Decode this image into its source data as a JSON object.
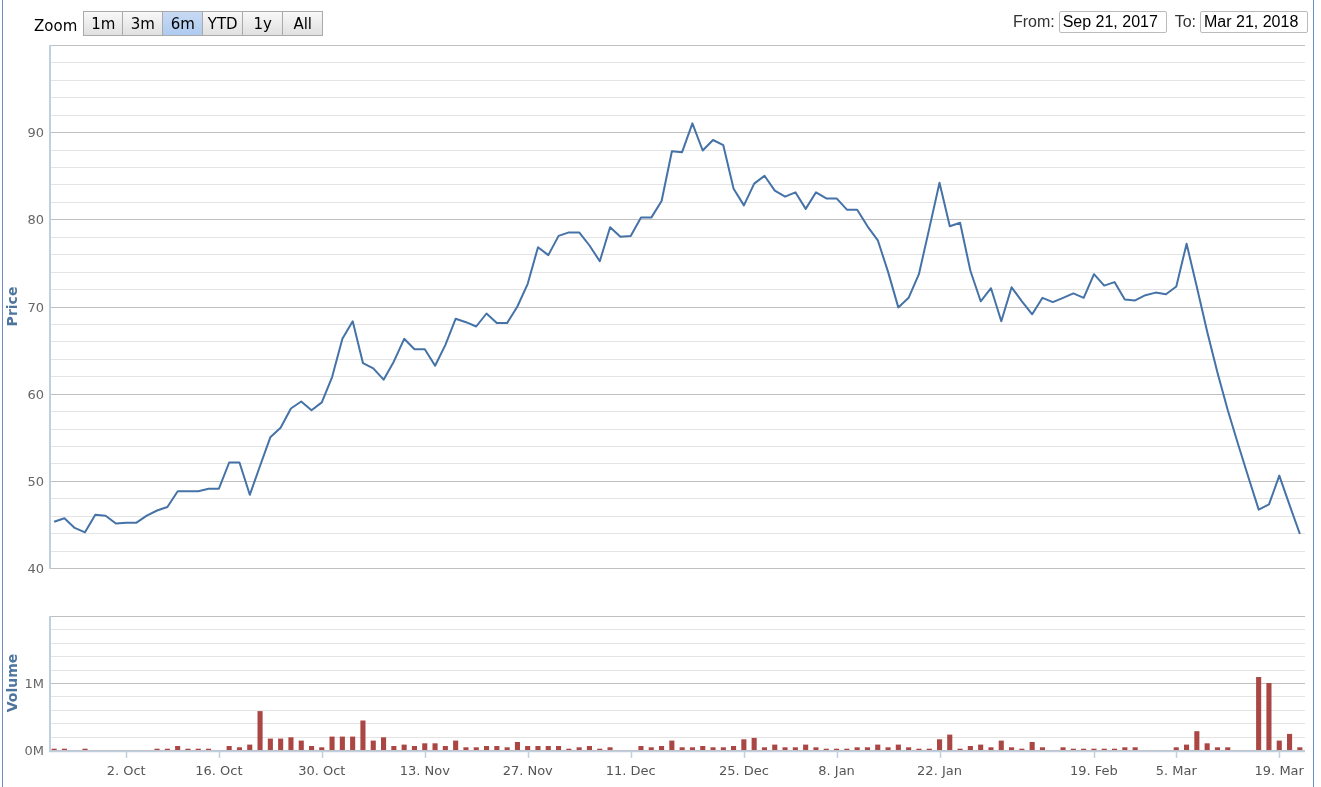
{
  "range_selector": {
    "label": "Zoom",
    "buttons": [
      {
        "label": "1m",
        "selected": false
      },
      {
        "label": "3m",
        "selected": false
      },
      {
        "label": "6m",
        "selected": true
      },
      {
        "label": "YTD",
        "selected": false
      },
      {
        "label": "1y",
        "selected": false
      },
      {
        "label": "All",
        "selected": false
      }
    ]
  },
  "date_range": {
    "from_label": "From:",
    "from": "Sep 21, 2017",
    "to_label": "To:",
    "to": "Mar 21, 2018"
  },
  "price_chart": {
    "chart_data": {
      "type": "line",
      "ylabel": "Price",
      "series": [
        {
          "color": "#4572a7",
          "values": [
            45.3,
            45.7,
            44.6,
            44.1,
            46.1,
            46.0,
            45.1,
            45.2,
            45.2,
            46.0,
            46.6,
            47.0,
            48.8,
            48.8,
            48.8,
            49.1,
            49.1,
            52.1,
            52.1,
            48.4,
            51.7,
            55.0,
            56.1,
            58.3,
            59.1,
            58.1,
            59.0,
            61.9,
            66.3,
            68.3,
            63.5,
            62.9,
            61.6,
            63.7,
            66.3,
            65.1,
            65.1,
            63.2,
            65.6,
            68.6,
            68.2,
            67.7,
            69.2,
            68.1,
            68.1,
            70.0,
            72.6,
            76.8,
            75.9,
            78.1,
            78.5,
            78.5,
            77.0,
            75.2,
            79.1,
            78.0,
            78.1,
            80.2,
            80.2,
            82.1,
            87.8,
            87.7,
            91.0,
            87.9,
            89.1,
            88.5,
            83.5,
            81.6,
            84.1,
            85.0,
            83.3,
            82.6,
            83.1,
            81.2,
            83.1,
            82.4,
            82.4,
            81.1,
            81.1,
            79.2,
            77.6,
            74.0,
            69.9,
            71.0,
            73.7,
            78.9,
            84.2,
            79.2,
            79.6,
            74.1,
            70.6,
            72.1,
            68.3,
            72.2,
            70.6,
            69.1,
            71.0,
            70.5,
            71.0,
            71.5,
            71.0,
            73.7,
            72.4,
            72.8,
            70.8,
            70.7,
            71.3,
            71.6,
            71.4,
            72.3,
            77.2,
            72.2,
            67.1,
            62.4,
            58.1,
            54.2,
            50.4,
            46.7,
            47.3,
            50.6,
            47.2,
            43.9
          ]
        }
      ],
      "ylim": [
        40,
        100
      ],
      "yticks": [
        40,
        50,
        60,
        70,
        80,
        90
      ],
      "grid": true
    }
  },
  "volume_chart": {
    "chart_data": {
      "type": "bar",
      "ylabel": "Volume",
      "categories": [
        null,
        null,
        null,
        null,
        null,
        null,
        null,
        "2. Oct",
        null,
        null,
        null,
        null,
        null,
        null,
        null,
        null,
        "16. Oct",
        null,
        null,
        null,
        null,
        null,
        null,
        null,
        null,
        null,
        "30. Oct",
        null,
        null,
        null,
        null,
        null,
        null,
        null,
        null,
        null,
        "13. Nov",
        null,
        null,
        null,
        null,
        null,
        null,
        null,
        null,
        null,
        "27. Nov",
        null,
        null,
        null,
        null,
        null,
        null,
        null,
        null,
        null,
        "11. Dec",
        null,
        null,
        null,
        null,
        null,
        null,
        null,
        null,
        null,
        null,
        "25. Dec",
        null,
        null,
        null,
        null,
        null,
        null,
        null,
        null,
        "8. Jan",
        null,
        null,
        null,
        null,
        null,
        null,
        null,
        null,
        null,
        "22. Jan",
        null,
        null,
        null,
        null,
        null,
        null,
        null,
        null,
        null,
        null,
        null,
        null,
        null,
        null,
        "19. Feb",
        null,
        null,
        null,
        null,
        null,
        null,
        null,
        "5. Mar",
        null,
        null,
        null,
        null,
        null,
        null,
        null,
        null,
        null,
        "19. Mar",
        null,
        null
      ],
      "series": [
        {
          "color": "#aa4643",
          "values": [
            0.02,
            0.02,
            null,
            0.02,
            null,
            null,
            null,
            null,
            null,
            null,
            0.02,
            0.02,
            0.06,
            0.02,
            0.02,
            0.02,
            null,
            0.06,
            0.04,
            0.08,
            0.58,
            0.17,
            0.17,
            0.19,
            0.14,
            0.06,
            0.04,
            0.2,
            0.2,
            0.2,
            0.44,
            0.14,
            0.19,
            0.06,
            0.08,
            0.06,
            0.1,
            0.1,
            0.06,
            0.14,
            0.04,
            0.04,
            0.06,
            0.06,
            0.04,
            0.12,
            0.06,
            0.06,
            0.06,
            0.06,
            0.02,
            0.04,
            0.06,
            0.02,
            0.04,
            null,
            null,
            0.06,
            0.04,
            0.06,
            0.14,
            0.04,
            0.04,
            0.06,
            0.04,
            0.04,
            0.06,
            0.16,
            0.18,
            0.04,
            0.08,
            0.04,
            0.04,
            0.08,
            0.04,
            0.02,
            0.02,
            0.02,
            0.04,
            0.04,
            0.08,
            0.04,
            0.08,
            0.04,
            0.02,
            0.02,
            0.16,
            0.23,
            0.02,
            0.06,
            0.08,
            0.04,
            0.14,
            0.04,
            0.02,
            0.12,
            0.04,
            null,
            0.04,
            0.02,
            0.02,
            0.02,
            0.02,
            0.02,
            0.04,
            0.04,
            null,
            null,
            null,
            0.04,
            0.08,
            0.28,
            0.1,
            0.04,
            0.04,
            null,
            null,
            1.09,
            1.0,
            0.14,
            0.24,
            0.04
          ]
        }
      ],
      "ylim": [
        0,
        2
      ],
      "grid": true,
      "yticks": [
        {
          "value": 0,
          "label": "0M"
        },
        {
          "value": 1,
          "label": "1M"
        }
      ]
    }
  }
}
